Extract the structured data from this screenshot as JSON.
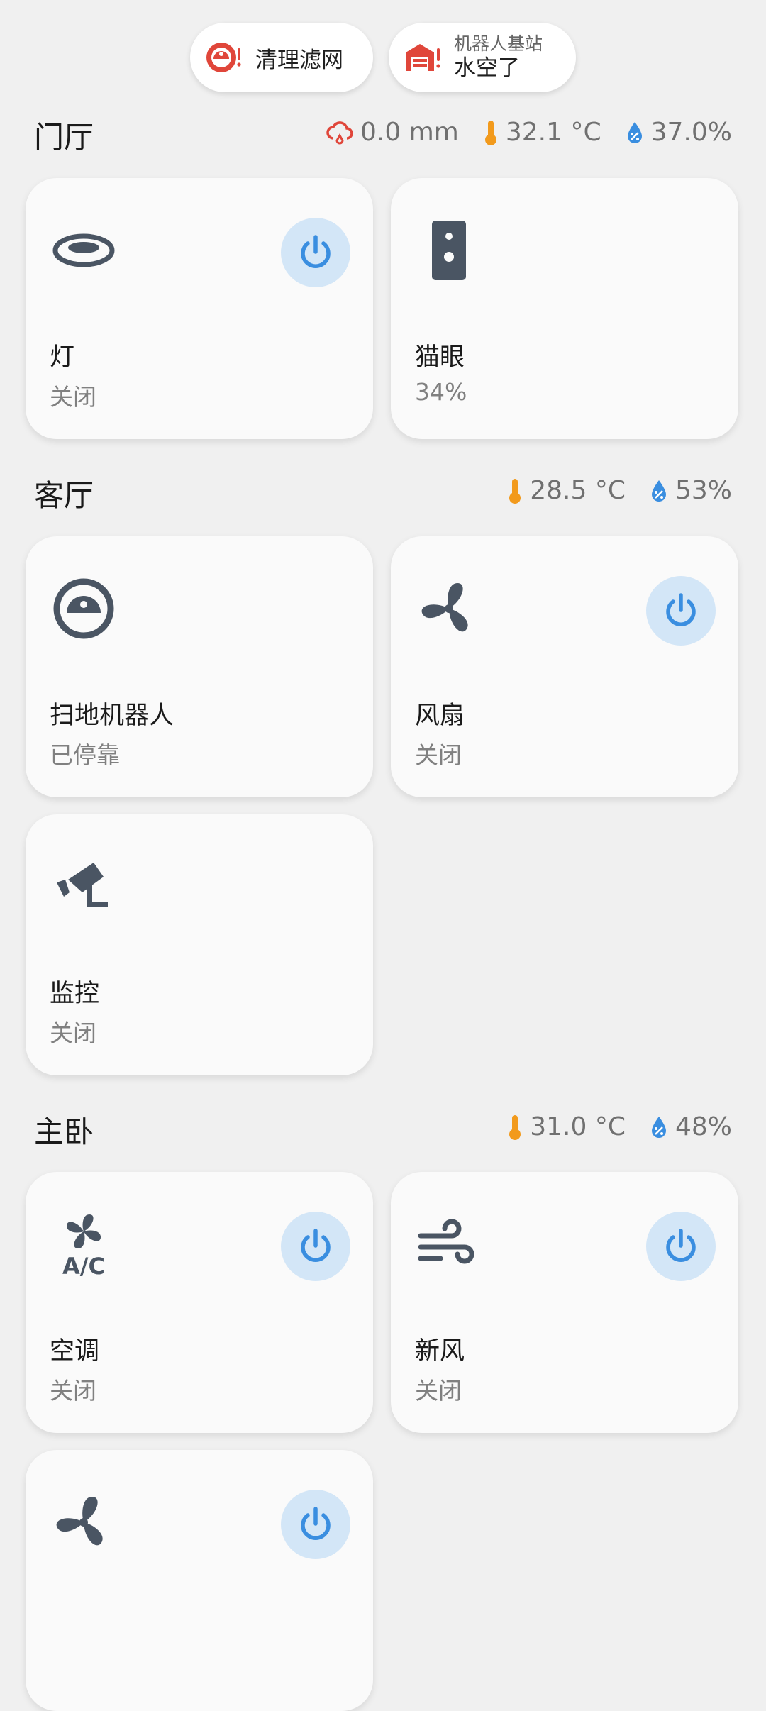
{
  "chips": {
    "filter": {
      "label": "清理滤网",
      "icon": "robot-vacuum-alert-icon"
    },
    "dock": {
      "sub_label": "机器人基站",
      "label": "水空了",
      "icon": "garage-alert-icon"
    }
  },
  "sections": [
    {
      "title": "门厅",
      "sensors": {
        "rain": "0.0 mm",
        "temperature": "32.1 °C",
        "humidity": "37.0%"
      },
      "cards": [
        {
          "name": "灯",
          "state": "关闭",
          "icon": "ceiling-light-icon",
          "has_power": true
        },
        {
          "name": "猫眼",
          "state": "34%",
          "icon": "doorbell-camera-icon",
          "has_power": false
        }
      ]
    },
    {
      "title": "客厅",
      "sensors": {
        "temperature": "28.5 °C",
        "humidity": "53%"
      },
      "cards": [
        {
          "name": "扫地机器人",
          "state": "已停靠",
          "icon": "robot-vacuum-icon",
          "has_power": false
        },
        {
          "name": "风扇",
          "state": "关闭",
          "icon": "fan-icon",
          "has_power": true
        },
        {
          "name": "监控",
          "state": "关闭",
          "icon": "cctv-camera-icon",
          "has_power": false
        }
      ]
    },
    {
      "title": "主卧",
      "sensors": {
        "temperature": "31.0 °C",
        "humidity": "48%"
      },
      "cards": [
        {
          "name": "空调",
          "state": "关闭",
          "icon": "air-conditioner-icon",
          "has_power": true
        },
        {
          "name": "新风",
          "state": "关闭",
          "icon": "wind-icon",
          "has_power": true
        },
        {
          "name": "",
          "state": "",
          "icon": "fan-icon",
          "has_power": true
        }
      ]
    }
  ],
  "colors": {
    "background": "#f0f0f0",
    "card": "#fafafa",
    "icon": "#4a5563",
    "power_bg": "#d3e6f7",
    "power_fg": "#3a8ee0",
    "alert_red": "#e0463a",
    "temperature": "#f29a1c",
    "humidity": "#3a8ee0"
  }
}
